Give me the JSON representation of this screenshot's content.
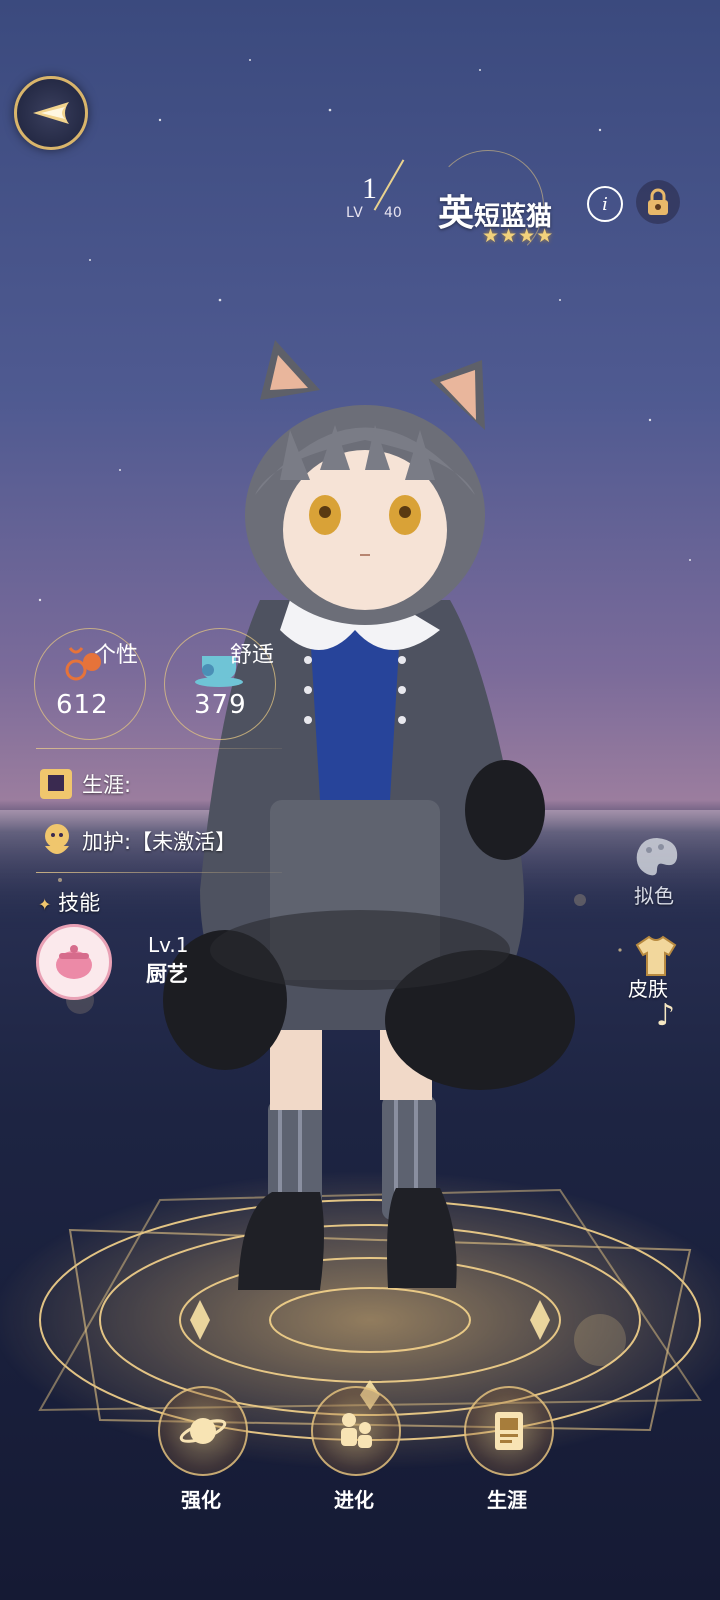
{
  "header": {
    "level_current": "1",
    "level_prefix": "LV",
    "level_max": "40",
    "name_first": "英",
    "name_rest": "短蓝猫",
    "stars": "★★★★"
  },
  "stats": {
    "personality_label": "个性",
    "personality_value": "612",
    "comfort_label": "舒适",
    "comfort_value": "379"
  },
  "side": {
    "career_label": "生涯:",
    "bless_label": "加护",
    "bless_status": ":【未激活】",
    "skill_title": "技能",
    "skill_level": "Lv.1",
    "skill_name": "厨艺"
  },
  "right_menu": {
    "dye_label": "拟色",
    "skin_label": "皮肤"
  },
  "bottom_menu": [
    {
      "label": "强化"
    },
    {
      "label": "进化"
    },
    {
      "label": "生涯"
    }
  ],
  "colors": {
    "gold": "#e2c482",
    "star": "#f2d27c"
  }
}
